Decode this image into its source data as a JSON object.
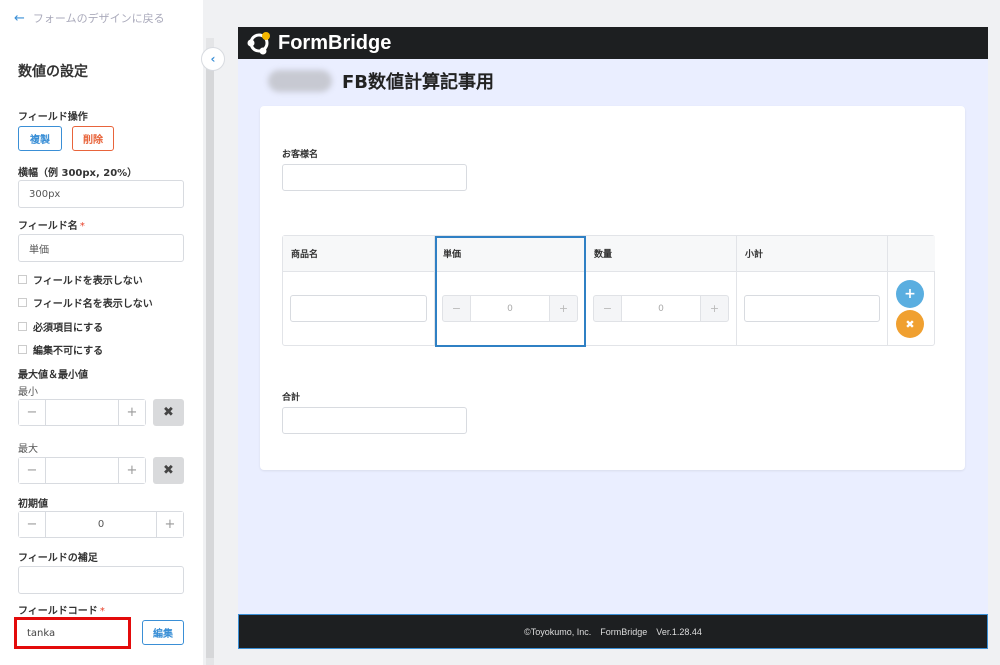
{
  "sidebar": {
    "back_link": "フォームのデザインに戻る",
    "title": "数値の設定",
    "field_ops_label": "フィールド操作",
    "copy_button": "複製",
    "delete_button": "削除",
    "width_label": "横幅（例 300px, 20%）",
    "width_value": "300px",
    "field_name_label": "フィールド名",
    "required_mark": "*",
    "field_name_value": "単価",
    "checkboxes": [
      "フィールドを表示しない",
      "フィールド名を表示しない",
      "必須項目にする",
      "編集不可にする"
    ],
    "minmax_label": "最大値＆最小値",
    "min_label": "最小",
    "min_value": "",
    "max_label": "最大",
    "max_value": "",
    "initial_label": "初期値",
    "initial_value": "0",
    "note_label": "フィールドの補足",
    "note_value": "",
    "code_label": "フィールドコード",
    "code_value": "tanka",
    "edit_button": "編集"
  },
  "preview": {
    "brand": "FormBridge",
    "form_title": "FB数値計算記事用",
    "customer_label": "お客様名",
    "customer_value": "",
    "table_headers": [
      "商品名",
      "単価",
      "数量",
      "小計"
    ],
    "unit_price_value": "0",
    "qty_value": "0",
    "total_label": "合計",
    "total_value": "",
    "footer": "©Toyokumo, Inc.　FormBridge　Ver.1.28.44"
  },
  "colors": {
    "accent": "#3a8fd6",
    "danger": "#e8643b",
    "add_circle": "#5aaee0",
    "remove_circle": "#f0a030",
    "highlight": "#e30b0b"
  },
  "icons": {
    "back": "arrow-left-icon",
    "collapse": "chevron-left-icon",
    "minus": "minus-icon",
    "plus": "plus-icon",
    "clear": "close-icon",
    "add_row": "plus-circle-icon",
    "remove_row": "close-circle-icon"
  }
}
